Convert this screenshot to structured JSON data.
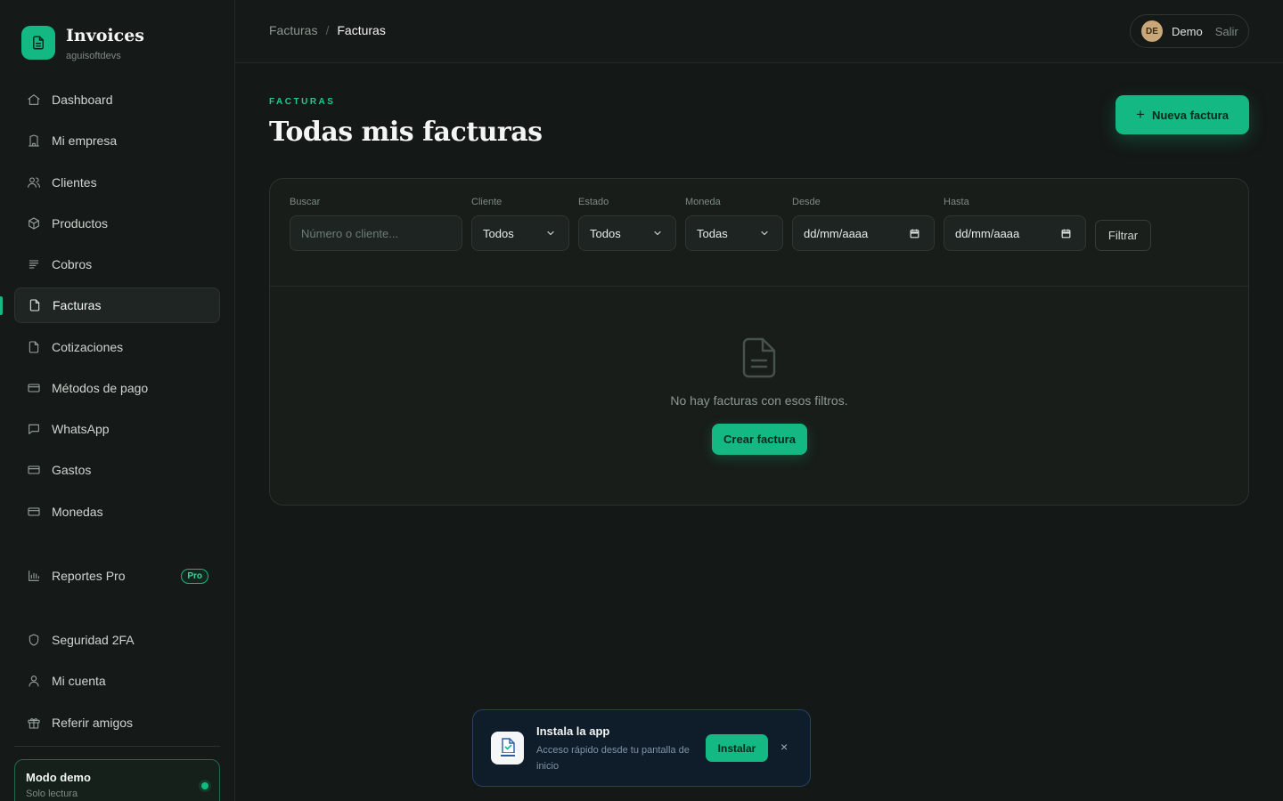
{
  "app": {
    "title": "Invoices",
    "subtitle": "aguisoftdevs"
  },
  "sidebar": {
    "items": [
      {
        "label": "Dashboard",
        "icon": "home-icon"
      },
      {
        "label": "Mi empresa",
        "icon": "building-icon"
      },
      {
        "label": "Clientes",
        "icon": "users-icon"
      },
      {
        "label": "Productos",
        "icon": "box-icon"
      },
      {
        "label": "Cobros",
        "icon": "list-icon"
      },
      {
        "label": "Facturas",
        "icon": "file-icon",
        "active": true
      },
      {
        "label": "Cotizaciones",
        "icon": "file-icon"
      },
      {
        "label": "Métodos de pago",
        "icon": "card-icon"
      },
      {
        "label": "WhatsApp",
        "icon": "message-icon"
      },
      {
        "label": "Gastos",
        "icon": "card-icon"
      },
      {
        "label": "Monedas",
        "icon": "card-icon"
      }
    ],
    "reports": {
      "label": "Reportes Pro",
      "badge": "Pro",
      "icon": "bar-chart-icon"
    },
    "account_items": [
      {
        "label": "Seguridad 2FA",
        "icon": "shield-icon"
      },
      {
        "label": "Mi cuenta",
        "icon": "user-icon"
      },
      {
        "label": "Referir amigos",
        "icon": "gift-icon"
      }
    ],
    "demo": {
      "title": "Modo demo",
      "subtitle": "Solo lectura"
    }
  },
  "header": {
    "breadcrumb": [
      "Facturas",
      "Facturas"
    ],
    "breadcrumb_sep": "/",
    "user": {
      "initials": "DE",
      "name": "Demo",
      "logout": "Salir"
    }
  },
  "main": {
    "eyebrow": "FACTURAS",
    "title": "Todas mis facturas",
    "new_button": "Nueva factura",
    "filters": {
      "search": {
        "label": "Buscar",
        "placeholder": "Número o cliente..."
      },
      "client": {
        "label": "Cliente",
        "value": "Todos"
      },
      "status": {
        "label": "Estado",
        "value": "Todos"
      },
      "currency": {
        "label": "Moneda",
        "value": "Todas"
      },
      "from": {
        "label": "Desde",
        "value": "dd/mm/aaaa"
      },
      "to": {
        "label": "Hasta",
        "value": "dd/mm/aaaa"
      },
      "apply_button": "Filtrar"
    },
    "empty": {
      "message": "No hay facturas con esos filtros.",
      "create_button": "Crear factura"
    }
  },
  "toast": {
    "title": "Instala la app",
    "subtitle": "Acceso rápido desde tu pantalla de inicio",
    "install_button": "Instalar",
    "close": "×"
  },
  "colors": {
    "accent": "#13b883",
    "background": "#141816",
    "sidebar": "#151917",
    "card": "#181d1a",
    "toast": "#0f1c2a"
  }
}
